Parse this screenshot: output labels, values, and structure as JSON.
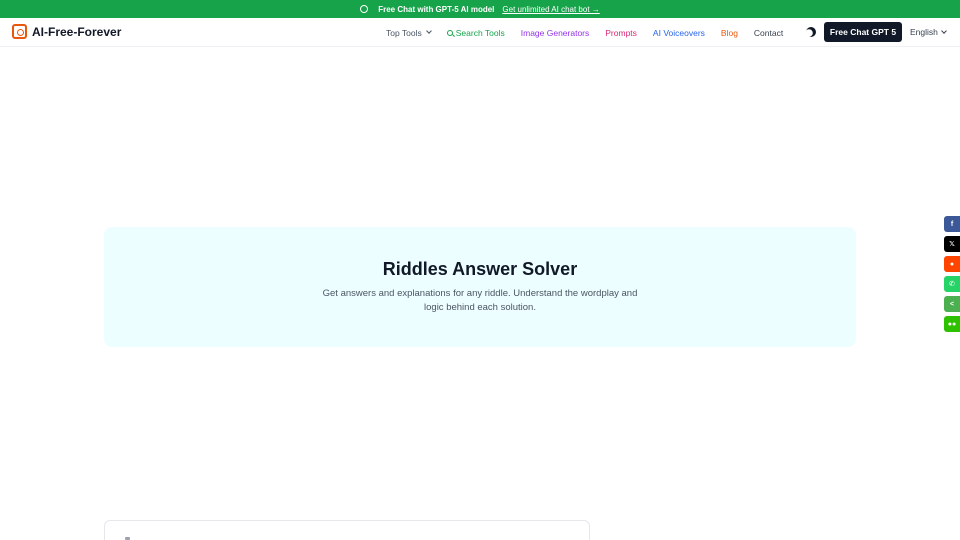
{
  "announcement": {
    "text": "Free Chat with GPT-5 AI model",
    "link": "Get unlimited AI chat bot →"
  },
  "brand": {
    "name": "AI-Free-Forever"
  },
  "nav": {
    "top_tools": "Top Tools",
    "search_tools": "Search Tools",
    "image_generators": "Image Generators",
    "prompts": "Prompts",
    "ai_voiceovers": "AI Voiceovers",
    "blog": "Blog",
    "contact": "Contact",
    "cta": "Free Chat GPT 5",
    "language": "English"
  },
  "hero": {
    "title": "Riddles Answer Solver",
    "description": "Get answers and explanations for any riddle. Understand the wordplay and logic behind each solution."
  },
  "share": [
    {
      "icon": "facebook-icon",
      "glyph": "f",
      "color": "#3b5998"
    },
    {
      "icon": "x-twitter-icon",
      "glyph": "𝕏",
      "color": "#000000"
    },
    {
      "icon": "reddit-icon",
      "glyph": "●",
      "color": "#ff4500"
    },
    {
      "icon": "whatsapp-icon",
      "glyph": "✆",
      "color": "#25d366"
    },
    {
      "icon": "sharethis-icon",
      "glyph": "<",
      "color": "#4caf50"
    },
    {
      "icon": "wechat-icon",
      "glyph": "●●",
      "color": "#2dc100"
    }
  ],
  "colors": {
    "banner": "#16a34a",
    "hero_bg": "#ecfeff",
    "cta_bg": "#111827"
  }
}
